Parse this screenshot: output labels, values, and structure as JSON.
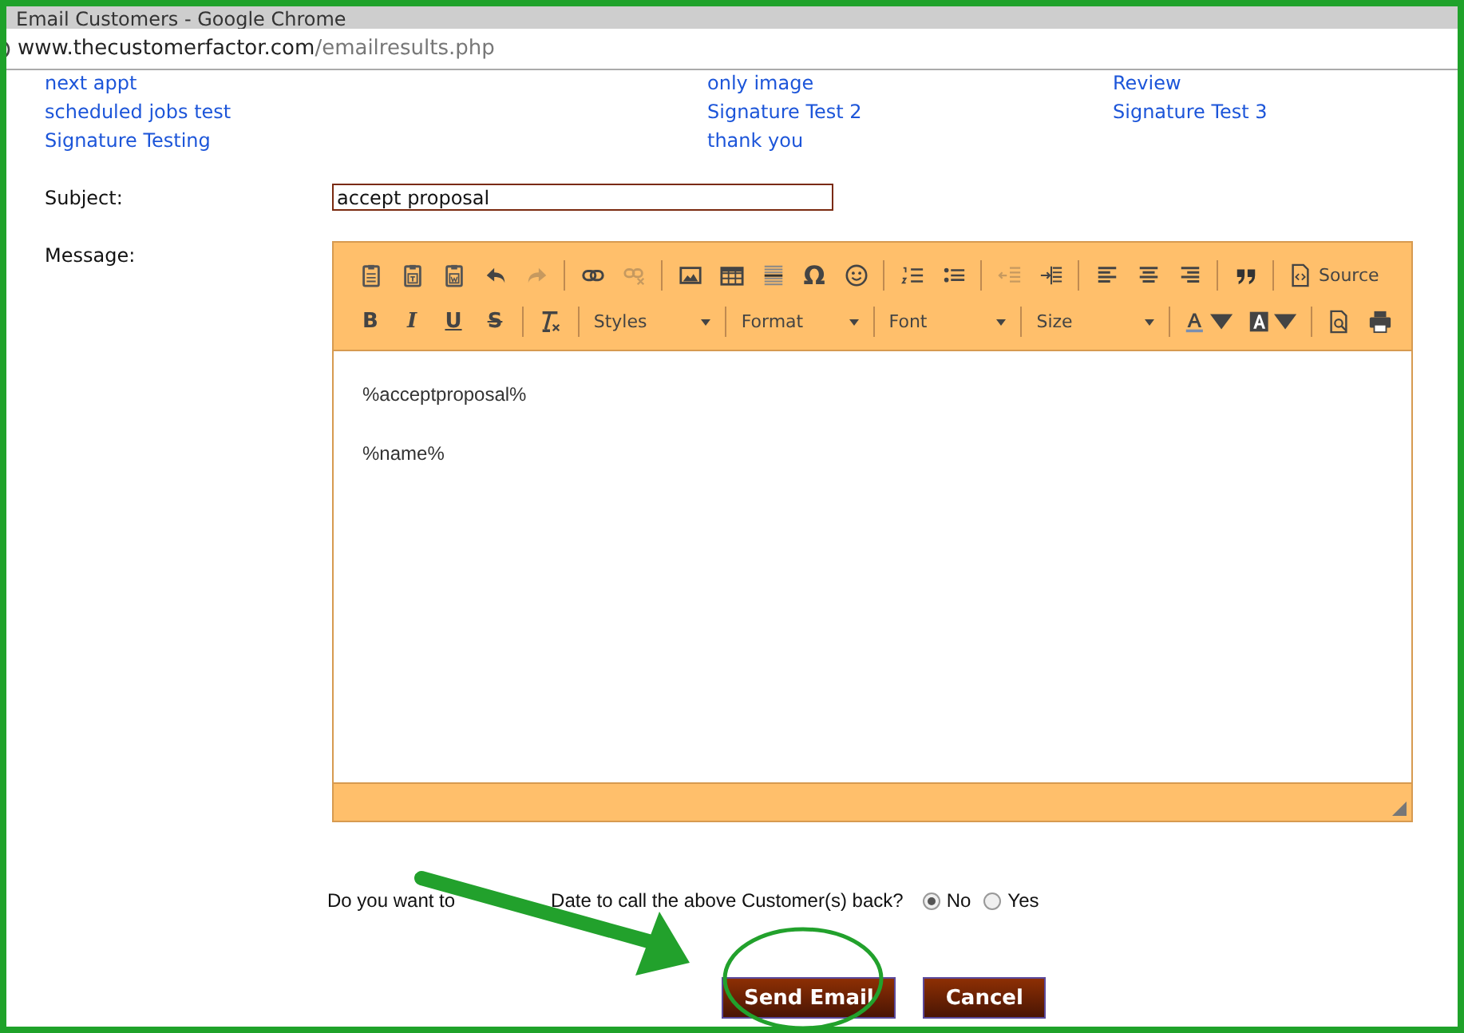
{
  "window": {
    "title": "Email Customers - Google Chrome"
  },
  "address_bar": {
    "host": "www.thecustomerfactor.com",
    "path": "/emailresults.php"
  },
  "template_links": [
    {
      "label": "next appt"
    },
    {
      "label": "only image"
    },
    {
      "label": "Review"
    },
    {
      "label": "scheduled jobs test"
    },
    {
      "label": "Signature Test 2"
    },
    {
      "label": "Signature Test 3"
    },
    {
      "label": "Signature Testing"
    },
    {
      "label": "thank you"
    }
  ],
  "subject": {
    "label": "Subject:",
    "value": "accept proposal"
  },
  "message": {
    "label": "Message:",
    "toolbar_rows": [
      [
        {
          "kind": "icon",
          "disabled": false
        },
        {
          "kind": "icon",
          "disabled": false
        },
        {
          "kind": "icon",
          "disabled": false
        },
        {
          "kind": "icon",
          "disabled": false
        },
        {
          "kind": "icon",
          "disabled": true
        },
        {
          "kind": "separator"
        },
        {
          "kind": "icon",
          "disabled": false
        },
        {
          "kind": "icon",
          "disabled": true
        },
        {
          "kind": "separator"
        },
        {
          "kind": "icon",
          "disabled": false
        },
        {
          "kind": "icon",
          "disabled": false
        },
        {
          "kind": "icon",
          "disabled": false
        },
        {
          "kind": "glyph",
          "label": "Ω",
          "disabled": false
        },
        {
          "kind": "icon",
          "disabled": false
        },
        {
          "kind": "separator"
        },
        {
          "kind": "icon",
          "disabled": false
        },
        {
          "kind": "icon",
          "disabled": false
        },
        {
          "kind": "separator"
        },
        {
          "kind": "icon",
          "disabled": true
        },
        {
          "kind": "icon",
          "disabled": false
        },
        {
          "kind": "separator"
        },
        {
          "kind": "icon",
          "disabled": false
        },
        {
          "kind": "icon",
          "disabled": false
        },
        {
          "kind": "icon",
          "disabled": false
        },
        {
          "kind": "separator"
        },
        {
          "kind": "icon",
          "disabled": false
        },
        {
          "kind": "separator"
        },
        {
          "kind": "labeled",
          "label": "Source",
          "disabled": false
        }
      ],
      [
        {
          "kind": "bold",
          "label": "B",
          "disabled": false
        },
        {
          "kind": "italic",
          "label": "I",
          "disabled": false
        },
        {
          "kind": "underline",
          "label": "U",
          "disabled": false
        },
        {
          "kind": "strike",
          "label": "S",
          "disabled": false
        },
        {
          "kind": "separator"
        },
        {
          "kind": "icon",
          "disabled": false
        },
        {
          "kind": "separator"
        },
        {
          "kind": "combo",
          "label": "Styles"
        },
        {
          "kind": "separator"
        },
        {
          "kind": "combo",
          "label": "Format"
        },
        {
          "kind": "separator"
        },
        {
          "kind": "combo",
          "label": "Font"
        },
        {
          "kind": "separator"
        },
        {
          "kind": "combo",
          "label": "Size"
        },
        {
          "kind": "separator"
        },
        {
          "kind": "icon",
          "disabled": false
        },
        {
          "kind": "icon",
          "disabled": false
        },
        {
          "kind": "separator"
        },
        {
          "kind": "icon",
          "disabled": false
        },
        {
          "kind": "icon",
          "disabled": false
        }
      ]
    ],
    "body": [
      "%acceptproposal%",
      "%name%"
    ]
  },
  "callback_question": {
    "visible_start": "Do you want to",
    "visible_end": "Date to call the above Customer(s) back?",
    "options": [
      {
        "label": "No",
        "selected": true
      },
      {
        "label": "Yes",
        "selected": false
      }
    ]
  },
  "buttons": [
    {
      "label": "Send Email"
    },
    {
      "label": "Cancel"
    }
  ]
}
